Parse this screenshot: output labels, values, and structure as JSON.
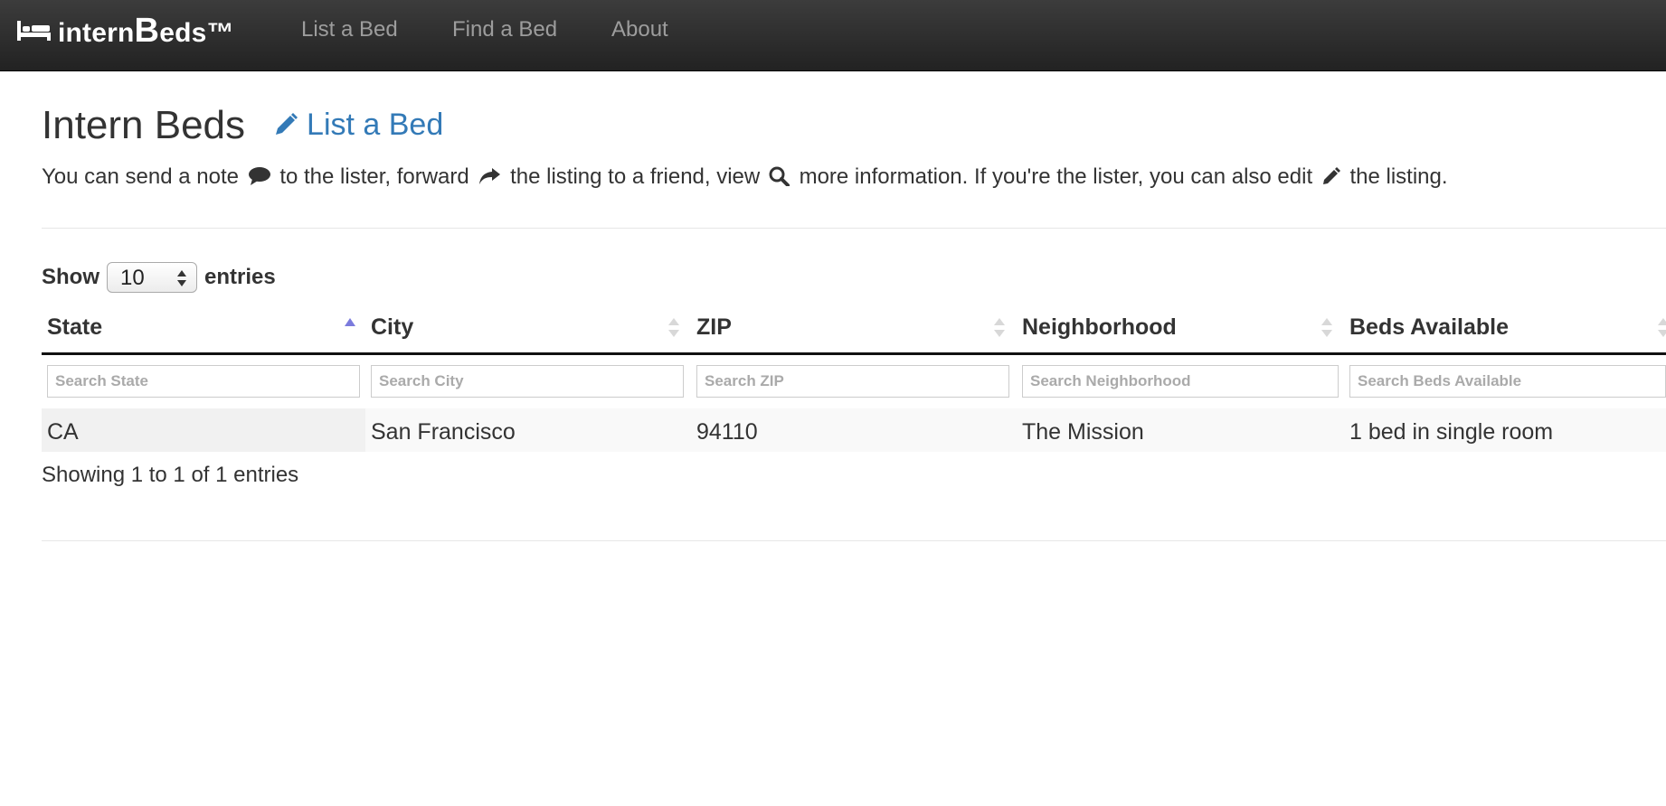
{
  "nav": {
    "brand_prefix": "intern",
    "brand_big": "B",
    "brand_suffix": "eds™",
    "links": [
      "List a Bed",
      "Find a Bed",
      "About"
    ]
  },
  "header": {
    "title": "Intern Beds",
    "list_link": "List a Bed"
  },
  "intro": {
    "p1": "You can send a note",
    "p2": "to the lister, forward",
    "p3": "the listing to a friend, view",
    "p4": "more information. If you're the lister, you can also edit",
    "p5": "the listing."
  },
  "length": {
    "show": "Show",
    "value": "10",
    "entries": "entries"
  },
  "table": {
    "columns": [
      "State",
      "City",
      "ZIP",
      "Neighborhood",
      "Beds Available"
    ],
    "placeholders": [
      "Search State",
      "Search City",
      "Search ZIP",
      "Search Neighborhood",
      "Search Beds Available"
    ],
    "sorted_column": "State",
    "rows": [
      [
        "CA",
        "San Francisco",
        "94110",
        "The Mission",
        "1 bed in single room"
      ]
    ]
  },
  "info": "Showing 1 to 1 of 1 entries",
  "icons": {
    "brand": "bed-icon",
    "header_link": "pencil-icon",
    "note": "comment-icon",
    "forward": "share-icon",
    "view": "search-icon",
    "edit": "pencil-icon"
  },
  "colors": {
    "navbar": "#222222",
    "link": "#337ab7",
    "sort_active": "#7b7bdd"
  }
}
